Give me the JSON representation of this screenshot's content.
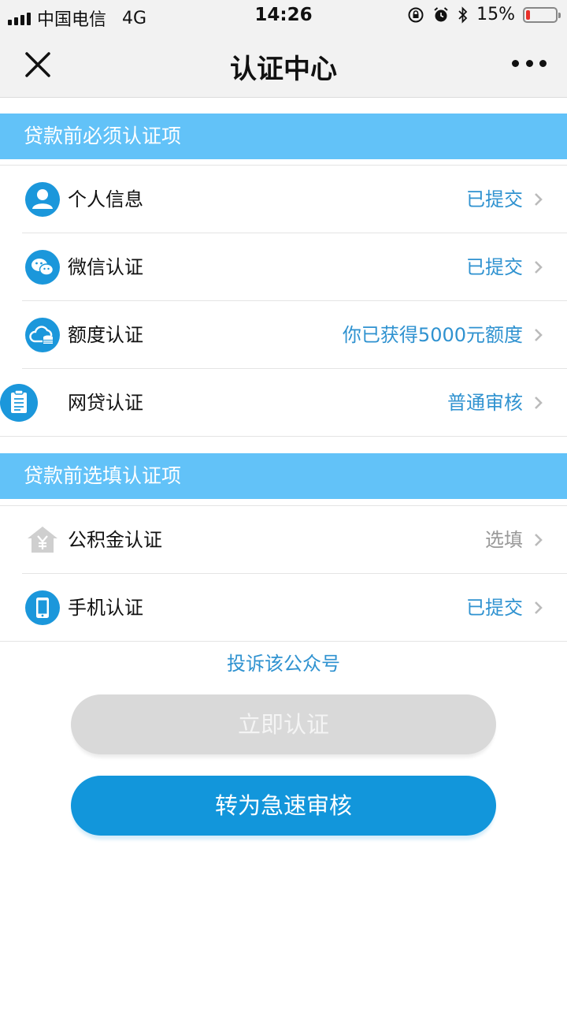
{
  "status_bar": {
    "carrier": "中国电信",
    "network": "4G",
    "time": "14:26",
    "battery_percent_text": "15%",
    "battery_level": 0.15
  },
  "nav": {
    "title": "认证中心"
  },
  "required_section": {
    "title": "贷款前必须认证项",
    "items": [
      {
        "label": "个人信息",
        "value": "已提交",
        "icon": "person-icon"
      },
      {
        "label": "微信认证",
        "value": "已提交",
        "icon": "wechat-icon"
      },
      {
        "label": "额度认证",
        "value": "你已获得5000元额度",
        "icon": "cloud-coins-icon"
      },
      {
        "label": "网贷认证",
        "value": "普通审核",
        "icon": "clipboard-icon"
      }
    ]
  },
  "optional_section": {
    "title": "贷款前选填认证项",
    "items": [
      {
        "label": "公积金认证",
        "value": "选填",
        "icon": "house-yen-icon"
      },
      {
        "label": "手机认证",
        "value": "已提交",
        "icon": "phone-icon"
      }
    ]
  },
  "complaint_link": "投诉该公众号",
  "buttons": {
    "verify_now": "立即认证",
    "fast_review": "转为急速审核"
  },
  "colors": {
    "accent": "#1296db",
    "section_header": "#62c2f8",
    "value_text": "#2f92d0",
    "disabled_button": "#d9d9d9",
    "battery_low": "#e8302a"
  }
}
